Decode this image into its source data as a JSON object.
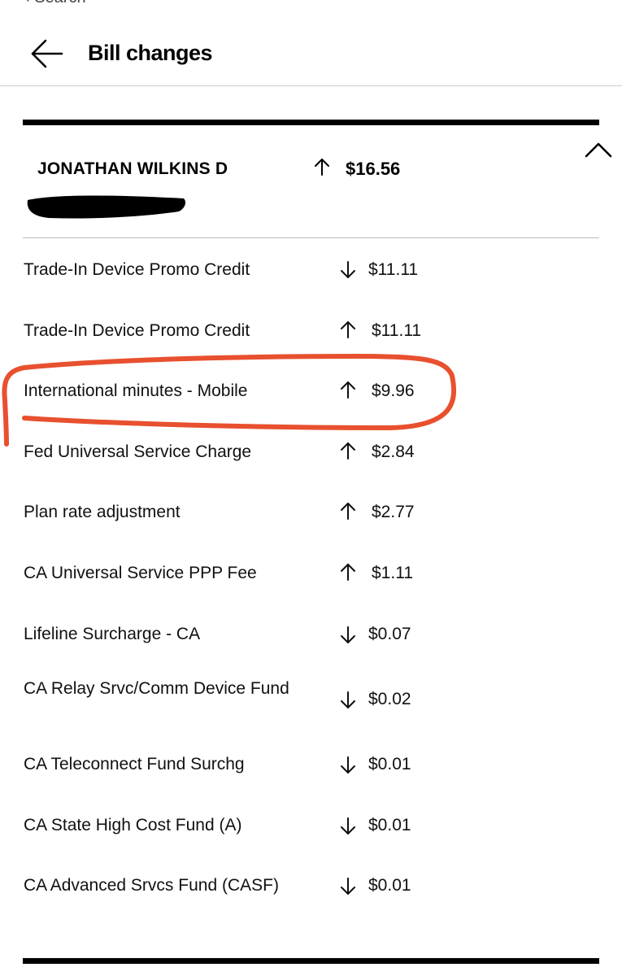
{
  "header": {
    "title": "Bill changes",
    "top_cut_text": "‹ Search"
  },
  "account": {
    "name": "JONATHAN WILKINS D",
    "direction": "up",
    "total": "$16.56"
  },
  "changes": [
    {
      "label": "Trade-In Device Promo Credit",
      "direction": "down",
      "amount": "$11.11"
    },
    {
      "label": "Trade-In Device Promo Credit",
      "direction": "up",
      "amount": "$11.11"
    },
    {
      "label": "International minutes - Mobile",
      "direction": "up",
      "amount": "$9.96"
    },
    {
      "label": "Fed Universal Service Charge",
      "direction": "up",
      "amount": "$2.84"
    },
    {
      "label": "Plan rate adjustment",
      "direction": "up",
      "amount": "$2.77"
    },
    {
      "label": "CA Universal Service PPP Fee",
      "direction": "up",
      "amount": "$1.11"
    },
    {
      "label": "Lifeline Surcharge - CA",
      "direction": "down",
      "amount": "$0.07"
    },
    {
      "label": "CA Relay Srvc/Comm Device Fund",
      "direction": "down",
      "amount": "$0.02"
    },
    {
      "label": "CA Teleconnect Fund Surchg",
      "direction": "down",
      "amount": "$0.01"
    },
    {
      "label": "CA State High Cost Fund (A)",
      "direction": "down",
      "amount": "$0.01"
    },
    {
      "label": "CA Advanced Srvcs Fund (CASF)",
      "direction": "down",
      "amount": "$0.01"
    }
  ],
  "icons": {
    "back": "arrow-left-icon",
    "collapse": "chevron-up-icon",
    "increase": "arrow-up-icon",
    "decrease": "arrow-down-icon"
  },
  "colors": {
    "highlight": "#e8502f",
    "rule": "#000000"
  }
}
